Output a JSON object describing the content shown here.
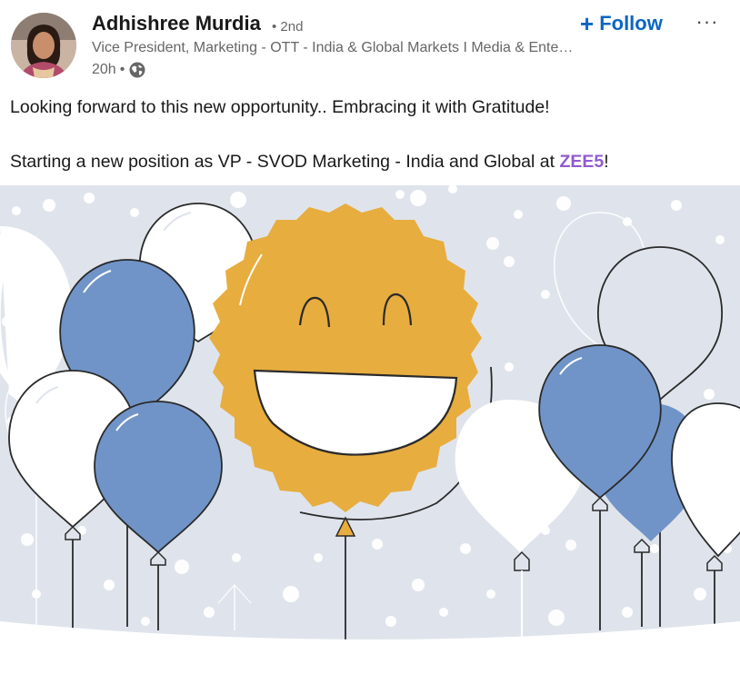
{
  "author": {
    "name": "Adhishree Murdia",
    "degree": "• 2nd",
    "headline": "Vice President, Marketing - OTT - India & Global Markets I Media & Entertainment",
    "time": "20h",
    "separator": "•",
    "visibility_icon": "globe-icon"
  },
  "actions": {
    "follow_label": "Follow",
    "follow_icon": "plus-icon",
    "more_label": "···",
    "more_icon": "more-icon"
  },
  "post": {
    "line1": "Looking forward to this new opportunity.. Embracing it with Gratitude!",
    "line2_prefix": "Starting a new position as VP - SVOD Marketing - India and Global at ",
    "company": "ZEE5",
    "line2_suffix": "!"
  },
  "image": {
    "icon": "celebration-illustration",
    "colors": {
      "background": "#dfe4ec",
      "smiley": "#e7ad3f",
      "blue_balloon": "#7094c8",
      "white_balloon": "#ffffff",
      "outline": "#2a2a2a"
    }
  },
  "colors": {
    "accent": "#0a66c2",
    "company_link": "#915bd0",
    "muted_text": "#666666"
  }
}
